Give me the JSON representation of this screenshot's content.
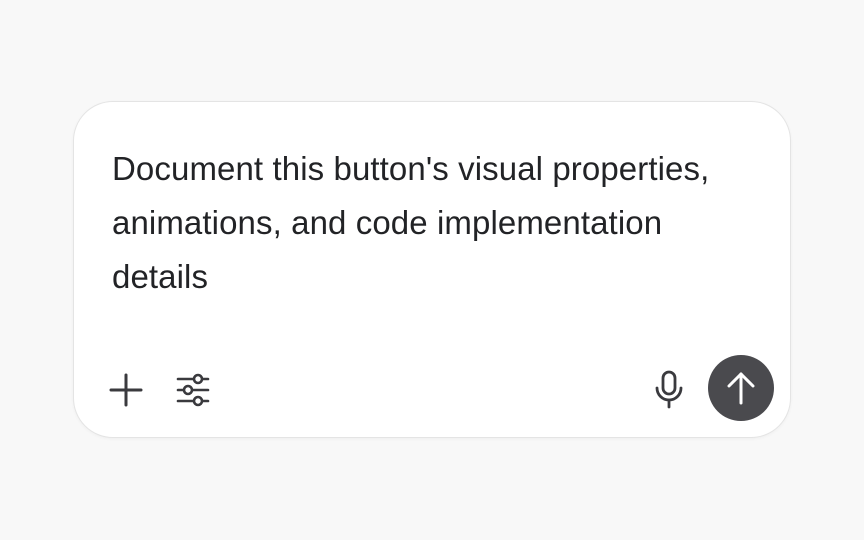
{
  "composer": {
    "prompt_text": "Document this button's visual properties, animations, and code implementation details"
  },
  "toolbar": {
    "left_icons": [
      "plus-icon",
      "sliders-icon"
    ],
    "right_icons": [
      "microphone-icon",
      "arrow-up-icon"
    ]
  },
  "colors": {
    "page_background": "#f8f8f8",
    "composer_background": "#ffffff",
    "text": "#222326",
    "icon": "#3a3a3e",
    "send_button": "#4a4a4e",
    "send_icon": "#ffffff"
  }
}
